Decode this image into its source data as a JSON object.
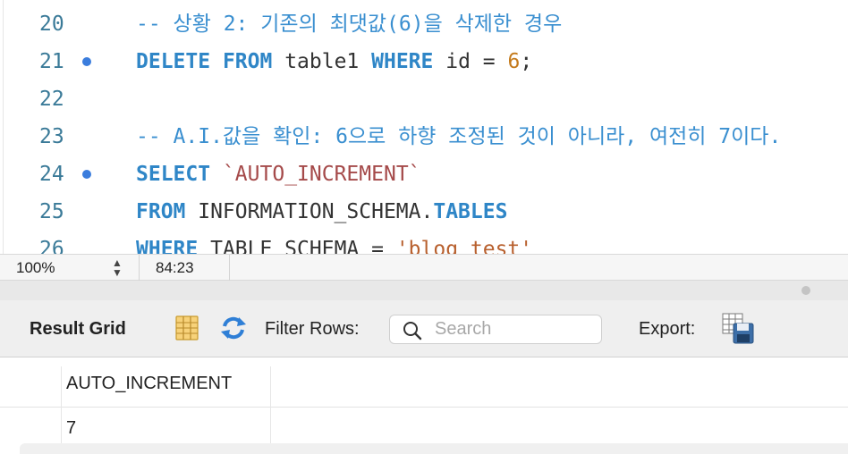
{
  "editor": {
    "lines": [
      {
        "num": "20",
        "breakpoint": false,
        "tokens": [
          {
            "t": "cmt",
            "v": "-- 상황 2: 기존의 최댓값(6)을 삭제한 경우"
          }
        ]
      },
      {
        "num": "21",
        "breakpoint": true,
        "tokens": [
          {
            "t": "kw",
            "v": "DELETE"
          },
          {
            "t": "plain",
            "v": " "
          },
          {
            "t": "kw",
            "v": "FROM"
          },
          {
            "t": "plain",
            "v": " table1 "
          },
          {
            "t": "kw",
            "v": "WHERE"
          },
          {
            "t": "plain",
            "v": " id = "
          },
          {
            "t": "num",
            "v": "6"
          },
          {
            "t": "plain",
            "v": ";"
          }
        ]
      },
      {
        "num": "22",
        "breakpoint": false,
        "tokens": []
      },
      {
        "num": "23",
        "breakpoint": false,
        "tokens": [
          {
            "t": "cmt",
            "v": "-- A.I.값을 확인: 6으로 하향 조정된 것이 아니라, 여전히 7이다."
          }
        ]
      },
      {
        "num": "24",
        "breakpoint": true,
        "tokens": [
          {
            "t": "kw",
            "v": "SELECT"
          },
          {
            "t": "plain",
            "v": "  "
          },
          {
            "t": "bt",
            "v": "`AUTO_INCREMENT`"
          }
        ]
      },
      {
        "num": "25",
        "breakpoint": false,
        "tokens": [
          {
            "t": "kw",
            "v": "FROM"
          },
          {
            "t": "plain",
            "v": "    INFORMATION_SCHEMA."
          },
          {
            "t": "kw2",
            "v": "TABLES"
          }
        ]
      },
      {
        "num": "26",
        "breakpoint": false,
        "tokens": [
          {
            "t": "kw",
            "v": "WHERE"
          },
          {
            "t": "plain",
            "v": "   TABLE_SCHEMA = "
          },
          {
            "t": "str",
            "v": "'blog_test'"
          }
        ]
      }
    ]
  },
  "statusbar": {
    "zoom": "100%",
    "cursor": "84:23"
  },
  "toolbar": {
    "result_grid_label": "Result Grid",
    "form_editor_icon": "form-editor-icon",
    "refresh_icon": "refresh-icon",
    "filter_label": "Filter Rows:",
    "search_placeholder": "Search",
    "search_value": "",
    "export_label": "Export:",
    "export_icon": "export-icon"
  },
  "grid": {
    "columns": [
      "AUTO_INCREMENT"
    ],
    "rows": [
      [
        "7"
      ]
    ]
  },
  "colors": {
    "keyword": "#2f86c7",
    "comment": "#3a8fd0",
    "number": "#c47a1c",
    "string": "#b8602e",
    "breakpoint": "#3b7ddd"
  }
}
